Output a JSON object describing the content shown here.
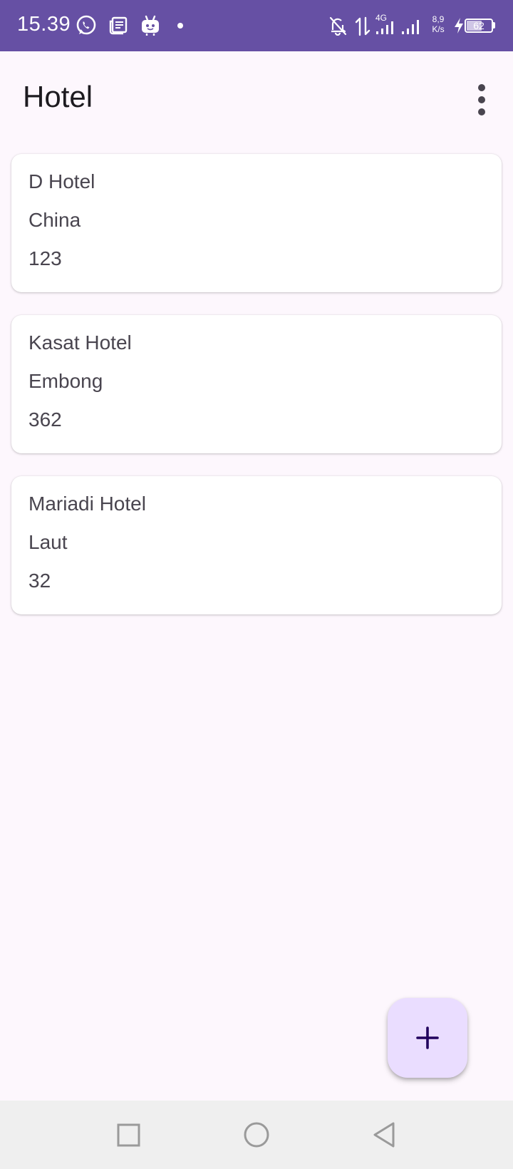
{
  "status_bar": {
    "time": "15.39",
    "network_type": "4G",
    "net_speed_value": "8,9",
    "net_speed_unit": "K/s",
    "battery_level": "62",
    "background_color": "#6650a4",
    "left_icons": [
      "whatsapp-icon",
      "news-icon",
      "bot-app-icon",
      "notification-dot-icon"
    ],
    "right_icons": [
      "bell-off-icon",
      "data-arrows-icon",
      "signal-4g-icon",
      "signal-icon",
      "charging-bolt-icon",
      "battery-icon"
    ]
  },
  "app_bar": {
    "title": "Hotel",
    "menu_icon": "more-vert-icon"
  },
  "hotels": [
    {
      "name": "D Hotel",
      "location": "China",
      "number": "123"
    },
    {
      "name": "Kasat Hotel",
      "location": "Embong",
      "number": "362"
    },
    {
      "name": "Mariadi Hotel",
      "location": "Laut",
      "number": "32"
    }
  ],
  "fab": {
    "icon": "plus-icon",
    "color": "#eaddff"
  },
  "nav_bar": {
    "buttons": [
      "recents-square-icon",
      "home-circle-icon",
      "back-triangle-icon"
    ]
  },
  "colors": {
    "background": "#fdf7fd",
    "text_primary": "#1d1b20",
    "text_secondary": "#49454f",
    "accent": "#6650a4"
  }
}
